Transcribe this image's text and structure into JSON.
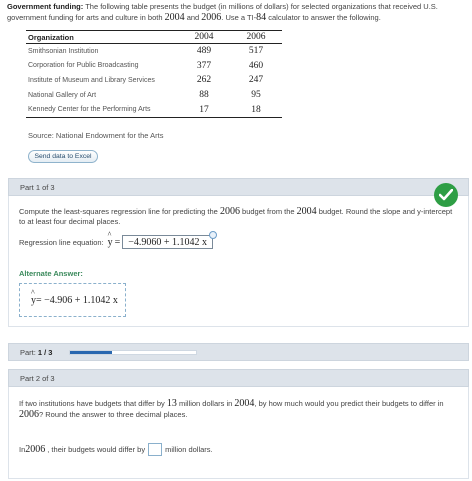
{
  "intro": {
    "lead": "Government funding:",
    "text_a": " The following table presents the budget (in millions of dollars) for selected organizations that received U.S. government funding for arts and culture in both ",
    "year1": "2004",
    "text_b": " and ",
    "year2": "2006",
    "text_c": ". Use a TI-",
    "calc": "84",
    "text_d": " calculator to answer the following."
  },
  "table": {
    "headers": [
      "Organization",
      "2004",
      "2006"
    ],
    "rows": [
      [
        "Smithsonian Institution",
        "489",
        "517"
      ],
      [
        "Corporation for Public Broadcasting",
        "377",
        "460"
      ],
      [
        "Institute of Museum and Library Services",
        "262",
        "247"
      ],
      [
        "National Gallery of Art",
        "88",
        "95"
      ],
      [
        "Kennedy Center for the Performing Arts",
        "17",
        "18"
      ]
    ]
  },
  "source": "Source: National Endowment for the Arts",
  "excel_button": "Send data to Excel",
  "part1": {
    "header": "Part 1 of 3",
    "instr_a": "Compute the least-squares regression line for predicting the ",
    "year_a": "2006",
    "instr_b": " budget from the ",
    "year_b": "2004",
    "instr_c": " budget. Round the slope and y-intercept to at least four decimal places.",
    "eq_label": "Regression line equation: ",
    "yhat": "y",
    "eq_sign": "=",
    "answer": "−4.9060 + 1.1042 x",
    "alt_label": "Alternate Answer:",
    "alt_answer_lhs": "y",
    "alt_answer_rhs": " = −4.906 + 1.1042 x"
  },
  "progress": {
    "label": "Part: ",
    "value_text": "1 / 3",
    "fraction": 0.333
  },
  "part2": {
    "header": "Part 2 of 3",
    "q_a": "If two institutions have budgets that differ by ",
    "diff": "13",
    "q_b": " million dollars in ",
    "year_a": "2004",
    "q_c": ", by how much would you predict their budgets to differ in ",
    "year_b": "2006",
    "q_d": "? Round the answer to three decimal places.",
    "ans_a": "In ",
    "ans_year": "2006",
    "ans_b": ", their budgets would differ by",
    "ans_c": "million dollars."
  },
  "colors": {
    "check_green": "#2e9e45",
    "progress_blue": "#2a68b0",
    "header_bg": "#dde3ea",
    "alt_green": "#3b8a5c"
  }
}
